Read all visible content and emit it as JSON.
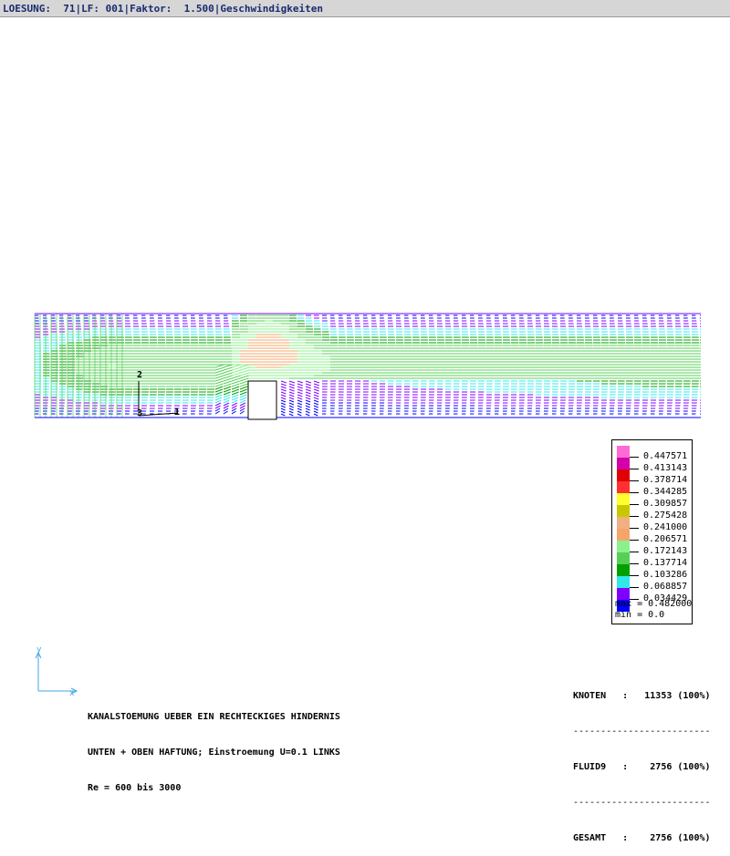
{
  "title_bar": {
    "text": "LOESUNG:  71|LF: 001|Faktor:  1.500|Geschwindigkeiten"
  },
  "legend": {
    "values": [
      "0.447571",
      "0.413143",
      "0.378714",
      "0.344285",
      "0.309857",
      "0.275428",
      "0.241000",
      "0.206571",
      "0.172143",
      "0.137714",
      "0.103286",
      "0.068857",
      "0.034429"
    ],
    "colors": [
      "#ff6bd6",
      "#d400a8",
      "#e00000",
      "#ff3030",
      "#ffff30",
      "#c8c800",
      "#f0b080",
      "#f5a46a",
      "#8cf08c",
      "#55d055",
      "#00a000",
      "#30e8e8",
      "#8000ff",
      "#0000ff"
    ],
    "max_text": "max = 0.482000",
    "min_text": "min = 0.0"
  },
  "axis_triad": {
    "label_2": "2",
    "label_1": "1",
    "label_3": "3"
  },
  "caption": {
    "line1": "KANALSTOEMUNG UEBER EIN RECHTECKIGES HINDERNIS",
    "line2": "UNTEN + OBEN HAFTUNG; Einstroemung U=0.1 LINKS",
    "line3": "Re = 600 bis 3000"
  },
  "stats": {
    "knoten": "KNOTEN   :   11353 (100%)",
    "sep1": "-------------------------",
    "fluid9": "FLUID9   :    2756 (100%)",
    "sep2": "-------------------------",
    "gesamt": "GESAMT   :    2756 (100%)"
  }
}
